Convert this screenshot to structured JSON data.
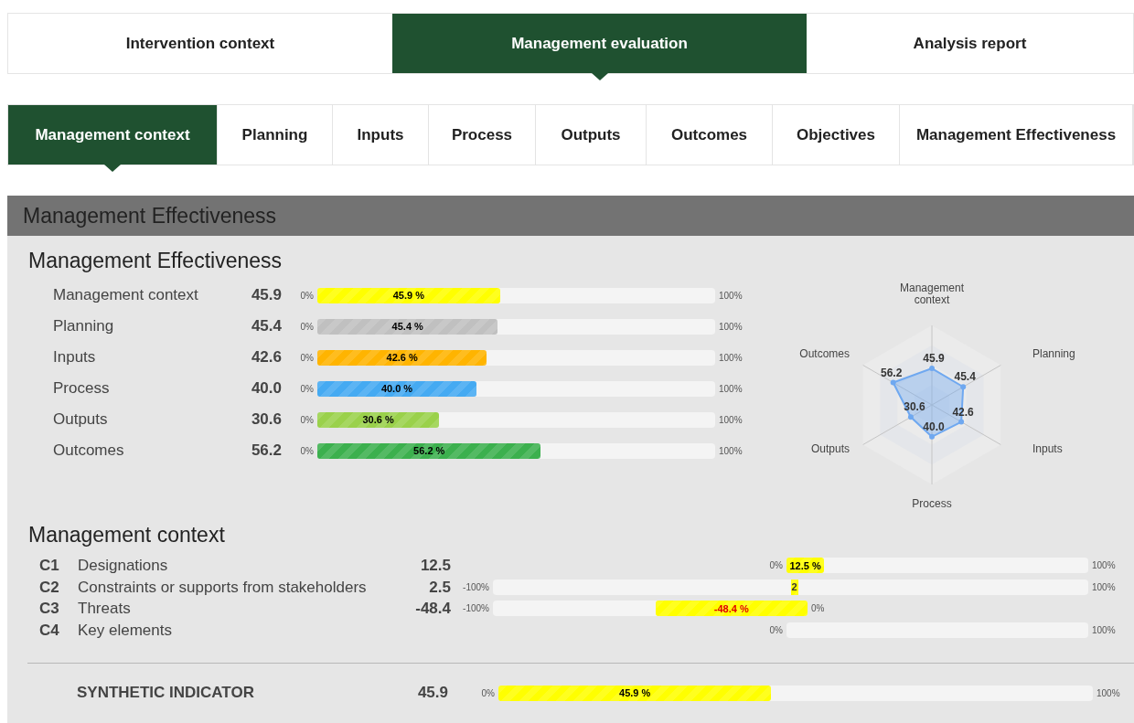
{
  "main_tabs": [
    {
      "label": "Intervention context",
      "selected": false
    },
    {
      "label": "Management evaluation",
      "selected": true
    },
    {
      "label": "Analysis report",
      "selected": false
    }
  ],
  "sub_tabs": [
    {
      "label": "Management context",
      "selected": true
    },
    {
      "label": "Planning",
      "selected": false
    },
    {
      "label": "Inputs",
      "selected": false
    },
    {
      "label": "Process",
      "selected": false
    },
    {
      "label": "Outputs",
      "selected": false
    },
    {
      "label": "Outcomes",
      "selected": false
    },
    {
      "label": "Objectives",
      "selected": false
    },
    {
      "label": "Management Effectiveness",
      "selected": false
    }
  ],
  "panel": {
    "header": "Management Effectiveness",
    "effectiveness": {
      "title": "Management Effectiveness",
      "rows": [
        {
          "label": "Management context",
          "value": "45.9",
          "min_label": "0%",
          "max_label": "100%",
          "bar_label": "45.9 %",
          "level": 0.459,
          "color": "#ffff00"
        },
        {
          "label": "Planning",
          "value": "45.4",
          "min_label": "0%",
          "max_label": "100%",
          "bar_label": "45.4 %",
          "level": 0.454,
          "color": "#c0c0c0"
        },
        {
          "label": "Inputs",
          "value": "42.6",
          "min_label": "0%",
          "max_label": "100%",
          "bar_label": "42.6 %",
          "level": 0.426,
          "color": "#ffb400"
        },
        {
          "label": "Process",
          "value": "40.0",
          "min_label": "0%",
          "max_label": "100%",
          "bar_label": "40.0 %",
          "level": 0.4,
          "color": "#45aaf2"
        },
        {
          "label": "Outputs",
          "value": "30.6",
          "min_label": "0%",
          "max_label": "100%",
          "bar_label": "30.6 %",
          "level": 0.306,
          "color": "#9ad14b"
        },
        {
          "label": "Outcomes",
          "value": "56.2",
          "min_label": "0%",
          "max_label": "100%",
          "bar_label": "56.2 %",
          "level": 0.562,
          "color": "#3cb04e"
        }
      ],
      "radar": {
        "axis_labels": [
          "Management context",
          "Outcomes",
          "Planning",
          "Outputs",
          "Inputs",
          "Process"
        ],
        "value_labels": [
          "45.9",
          "56.2",
          "45.4",
          "30.6",
          "42.6",
          "40.0"
        ]
      }
    },
    "context": {
      "title": "Management context",
      "rows": [
        {
          "code": "C1",
          "label": "Designations",
          "value": "12.5",
          "kind": "positive",
          "min_label": "0%",
          "max_label": "100%",
          "bar_label": "12.5 %",
          "level": 0.125
        },
        {
          "code": "C2",
          "label": "Constraints or supports from stakeholders",
          "value": "2.5",
          "kind": "bipolar",
          "min_label": "-100%",
          "max_label": "100%",
          "bar_label": "2"
        },
        {
          "code": "C3",
          "label": "Threats",
          "value": "-48.4",
          "kind": "negative",
          "min_label": "-100%",
          "max_label": "0%",
          "bar_label": "-48.4 %",
          "level": 0.484
        },
        {
          "code": "C4",
          "label": "Key elements",
          "kind": "positive",
          "min_label": "0%",
          "max_label": "100%"
        }
      ]
    },
    "synthetic": {
      "label": "SYNTHETIC INDICATOR",
      "value": "45.9",
      "min_label": "0%",
      "max_label": "100%",
      "bar_label": "45.9 %",
      "level": 0.459
    }
  }
}
